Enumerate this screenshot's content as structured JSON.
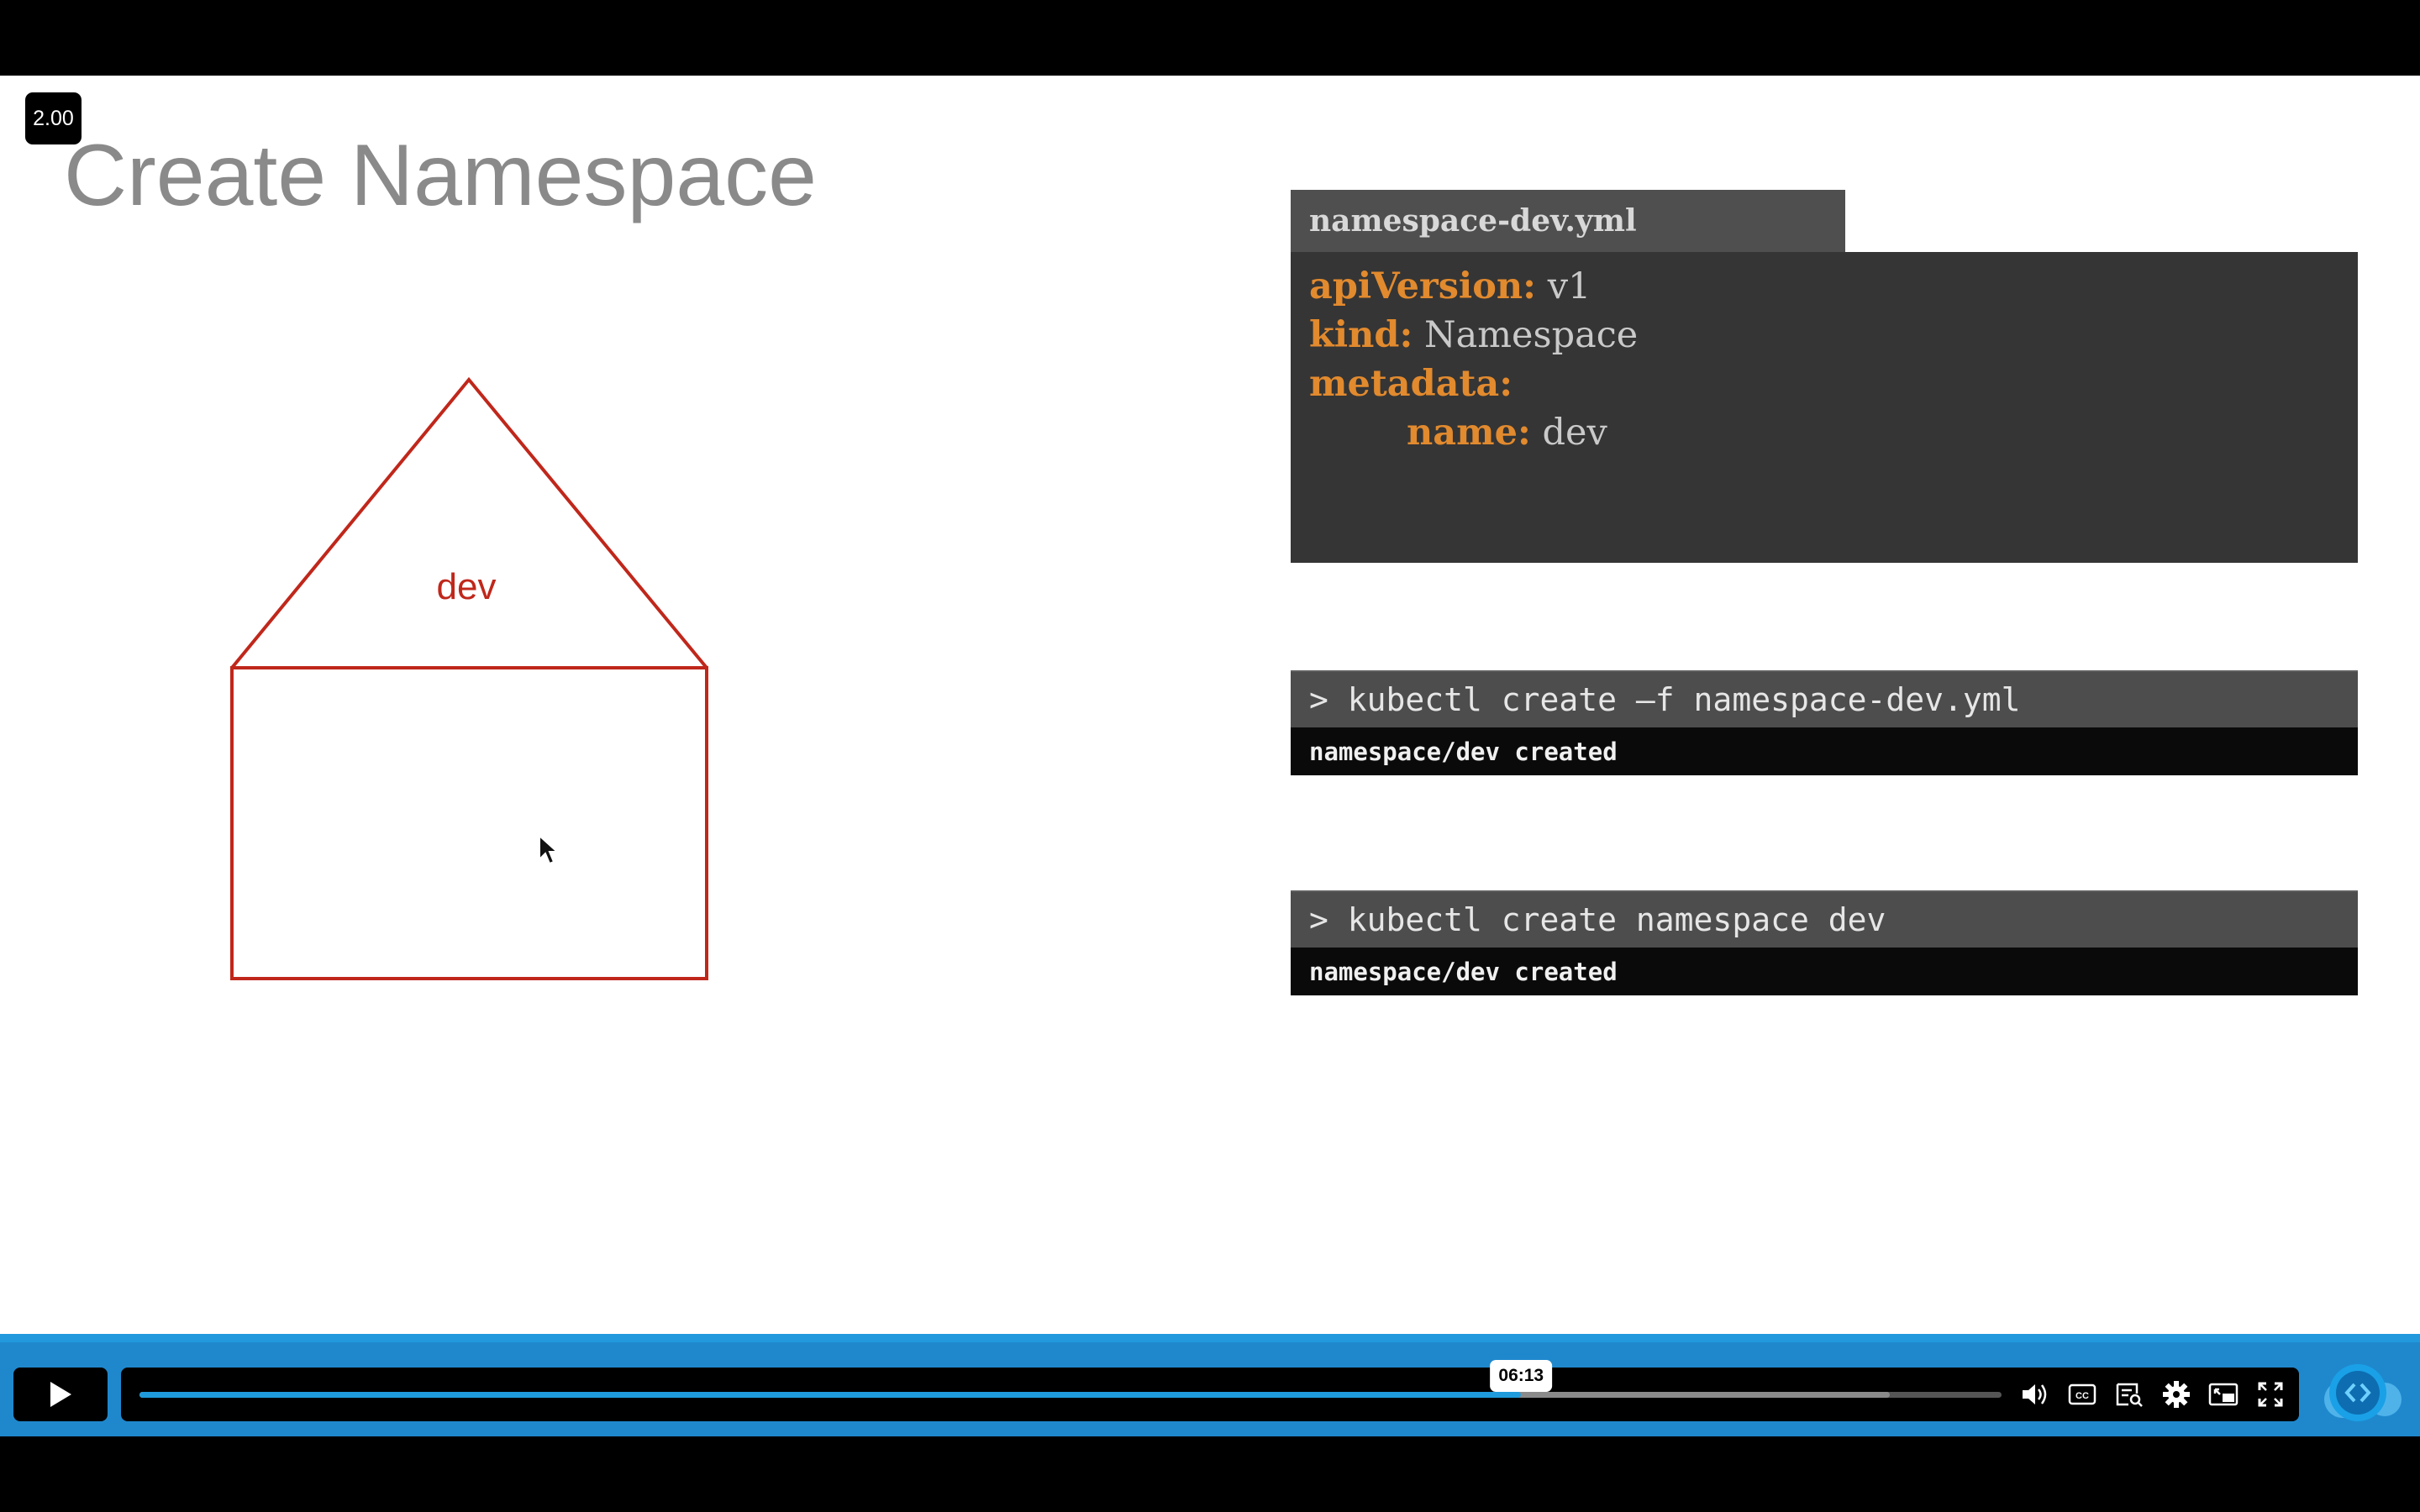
{
  "player": {
    "speed": "2.00",
    "current_time": "06:13",
    "progress_fraction": 0.742,
    "buffered_fraction": 0.94
  },
  "slide": {
    "title": "Create Namespace",
    "diagram_label": "dev",
    "diagram_color": "#c0271b",
    "yaml": {
      "filename": "namespace-dev.yml",
      "lines": [
        {
          "key": "apiVersion:",
          "value": "v1"
        },
        {
          "key": "kind:",
          "value": "Namespace"
        },
        {
          "key": "metadata:",
          "value": ""
        },
        {
          "key": "name:",
          "value": "dev"
        }
      ]
    },
    "commands": [
      {
        "prompt": "> kubectl create –f namespace-dev.yml",
        "output": "namespace/dev created"
      },
      {
        "prompt": "> kubectl create namespace dev",
        "output": "namespace/dev created"
      }
    ]
  },
  "controls": {
    "play_icon": "play-icon",
    "volume_icon": "volume-icon",
    "captions_icon": "closed-captions-icon",
    "transcript_icon": "transcript-icon",
    "settings_icon": "gear-icon",
    "pip_icon": "picture-in-picture-icon",
    "fullscreen_icon": "fullscreen-icon",
    "brand_icon": "code-brackets-logo"
  },
  "colors": {
    "accent": "#1f88cd",
    "yaml_key": "#e28a2e",
    "yaml_value": "#c9c9c9",
    "title_gray": "#8a8a8a"
  }
}
